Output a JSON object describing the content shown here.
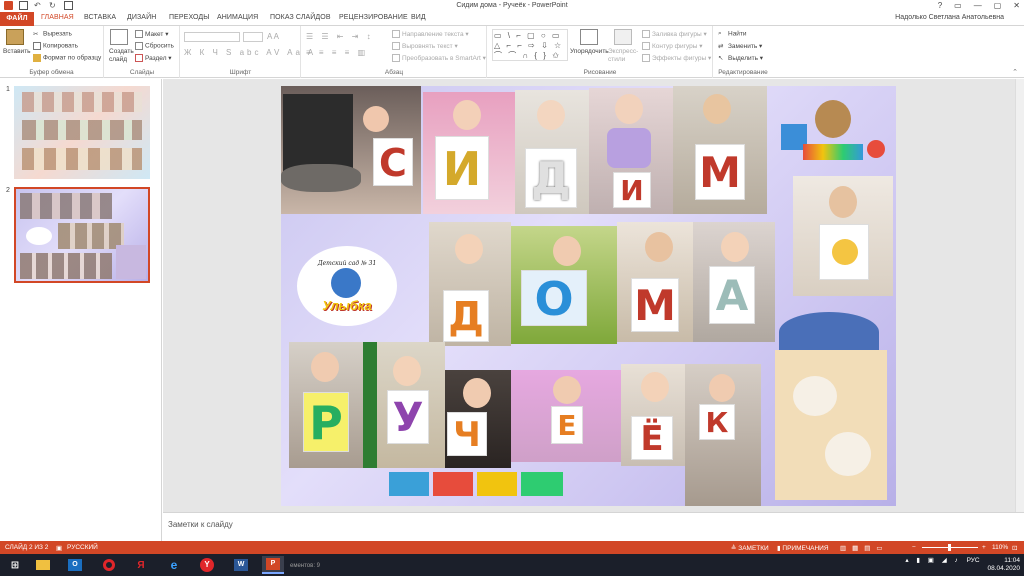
{
  "window": {
    "title": "Сидим дома - Ручеёк - PowerPoint",
    "controls": [
      "?",
      "▭",
      "—",
      "▢",
      "✕"
    ]
  },
  "tabs": {
    "file": "ФАЙЛ",
    "items": [
      "ГЛАВНАЯ",
      "ВСТАВКА",
      "ДИЗАЙН",
      "ПЕРЕХОДЫ",
      "АНИМАЦИЯ",
      "ПОКАЗ СЛАЙДОВ",
      "РЕЦЕНЗИРОВАНИЕ",
      "ВИД"
    ],
    "active": "ГЛАВНАЯ",
    "user": "Надолько Светлана Анатольевна"
  },
  "ribbon": {
    "clipboard": {
      "paste": "Вставить",
      "cut": "Вырезать",
      "copy": "Копировать",
      "format_painter": "Формат по образцу",
      "label": "Буфер обмена"
    },
    "slides": {
      "new_slide": "Создать слайд",
      "layout": "Макет",
      "reset": "Сбросить",
      "section": "Раздел",
      "label": "Слайды"
    },
    "font": {
      "label": "Шрифт"
    },
    "paragraph": {
      "text_direction": "Направление текста",
      "align_text": "Выровнять текст",
      "smartart": "Преобразовать в SmartArt",
      "label": "Абзац"
    },
    "drawing": {
      "arrange": "Упорядочить",
      "quick_styles": "Экспресс-стили",
      "shape_fill": "Заливка фигуры",
      "shape_outline": "Контур фигуры",
      "shape_effects": "Эффекты фигуры",
      "label": "Рисование"
    },
    "editing": {
      "find": "Найти",
      "replace": "Заменить",
      "select": "Выделить",
      "label": "Редактирование"
    }
  },
  "thumbnails": [
    {
      "number": "1",
      "selected": false
    },
    {
      "number": "2",
      "selected": true
    }
  ],
  "slide": {
    "logo_caption": "Детский сад № 31",
    "logo_name": "Улыбка",
    "row1_letters": [
      "С",
      "И",
      "Д",
      "И",
      "М"
    ],
    "row2_letters": [
      "Д",
      "О",
      "М",
      "А"
    ],
    "row3_letters": [
      "Р",
      "У",
      "Ч",
      "Е",
      "Ё",
      "К"
    ]
  },
  "notes": {
    "placeholder": "Заметки к слайду"
  },
  "status": {
    "slide_counter": "СЛАЙД 2 ИЗ 2",
    "language": "РУССКИЙ",
    "notes_btn": "ЗАМЕТКИ",
    "comments_btn": "ПРИМЕЧАНИЯ",
    "zoom": "110%"
  },
  "taskbar": {
    "elements_text": "ементов: 9",
    "lang": "РУС",
    "time": "11:04",
    "date": "08.04.2020"
  },
  "colors": {
    "accent": "#d24726",
    "taskbar": "#1b1f2a"
  }
}
